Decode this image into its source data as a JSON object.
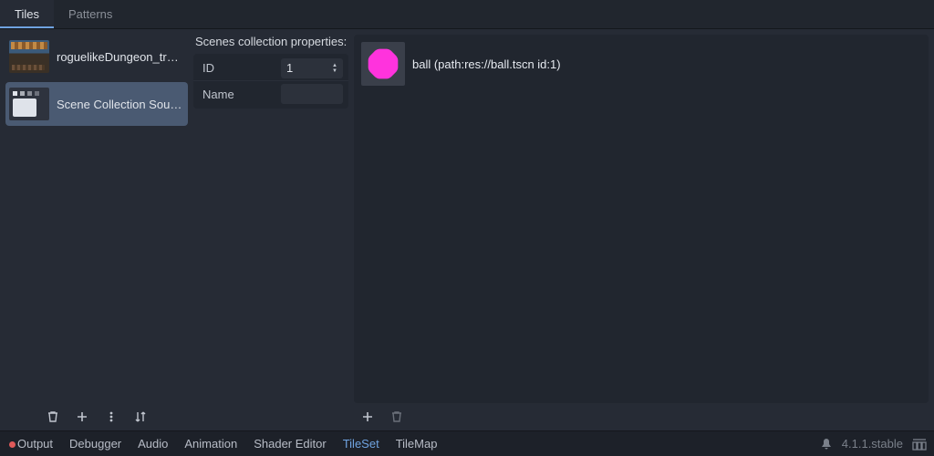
{
  "top_tabs": {
    "tiles": "Tiles",
    "patterns": "Patterns",
    "active": "tiles"
  },
  "sources": {
    "items": [
      {
        "label": "roguelikeDungeon_tran…",
        "selected": false
      },
      {
        "label": "Scene Collection Source…",
        "selected": true
      }
    ]
  },
  "properties": {
    "title": "Scenes collection properties:",
    "rows": {
      "id_label": "ID",
      "id_value": "1",
      "name_label": "Name",
      "name_value": ""
    }
  },
  "tiles": {
    "items": [
      {
        "label": "ball (path:res://ball.tscn id:1)"
      }
    ]
  },
  "bottom": {
    "output": "Output",
    "debugger": "Debugger",
    "audio": "Audio",
    "animation": "Animation",
    "shader_editor": "Shader Editor",
    "tileset": "TileSet",
    "tilemap": "TileMap",
    "active": "tileset"
  },
  "status": {
    "version": "4.1.1.stable"
  }
}
